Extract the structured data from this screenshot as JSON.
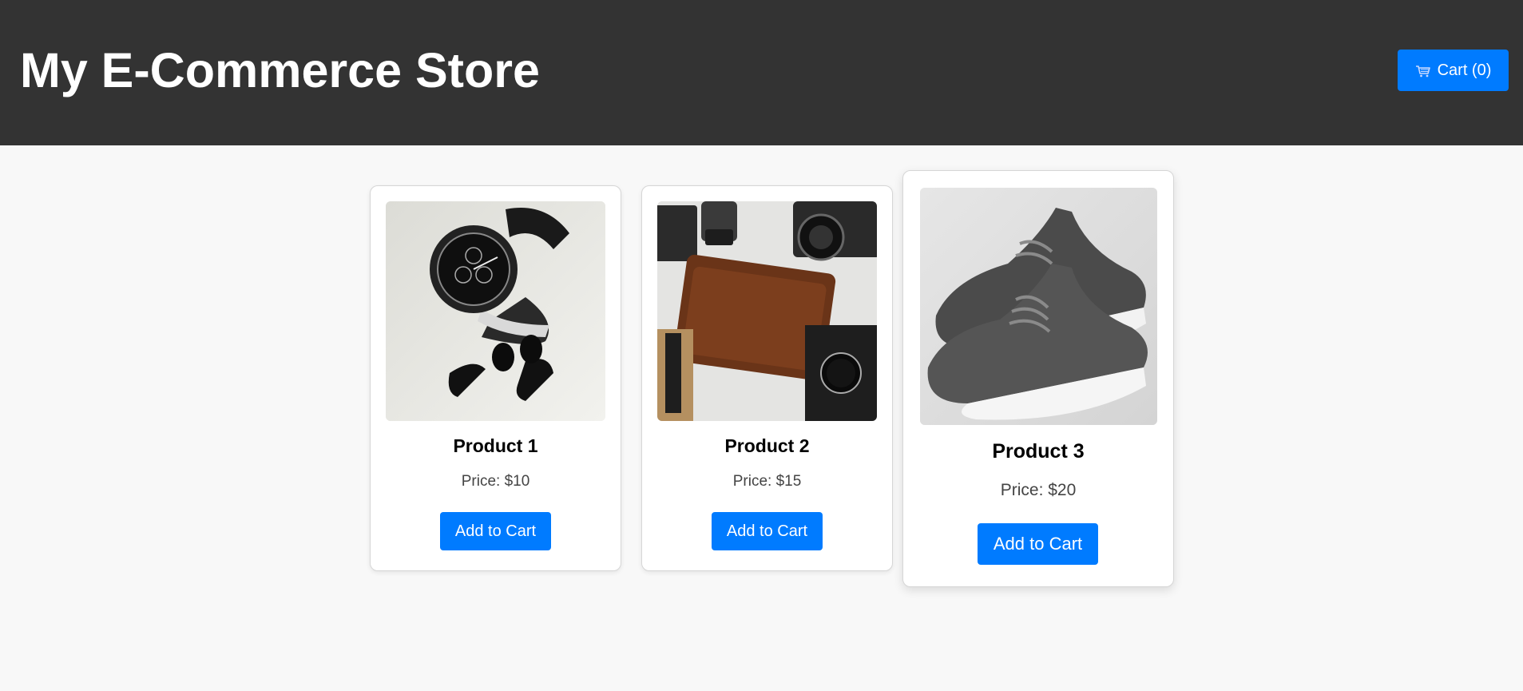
{
  "header": {
    "title": "My E-Commerce Store",
    "cart_label": "Cart (0)",
    "cart_icon": "shopping-cart-icon",
    "background": "#333333"
  },
  "accent_color": "#007bff",
  "products": [
    {
      "name": "Product 1",
      "price": "Price: $10",
      "button": "Add to Cart",
      "image": "watch-and-earbuds-image"
    },
    {
      "name": "Product 2",
      "price": "Price: $15",
      "button": "Add to Cart",
      "image": "wallet-camera-accessories-image"
    },
    {
      "name": "Product 3",
      "price": "Price: $20",
      "button": "Add to Cart",
      "image": "gray-sneakers-image"
    }
  ]
}
